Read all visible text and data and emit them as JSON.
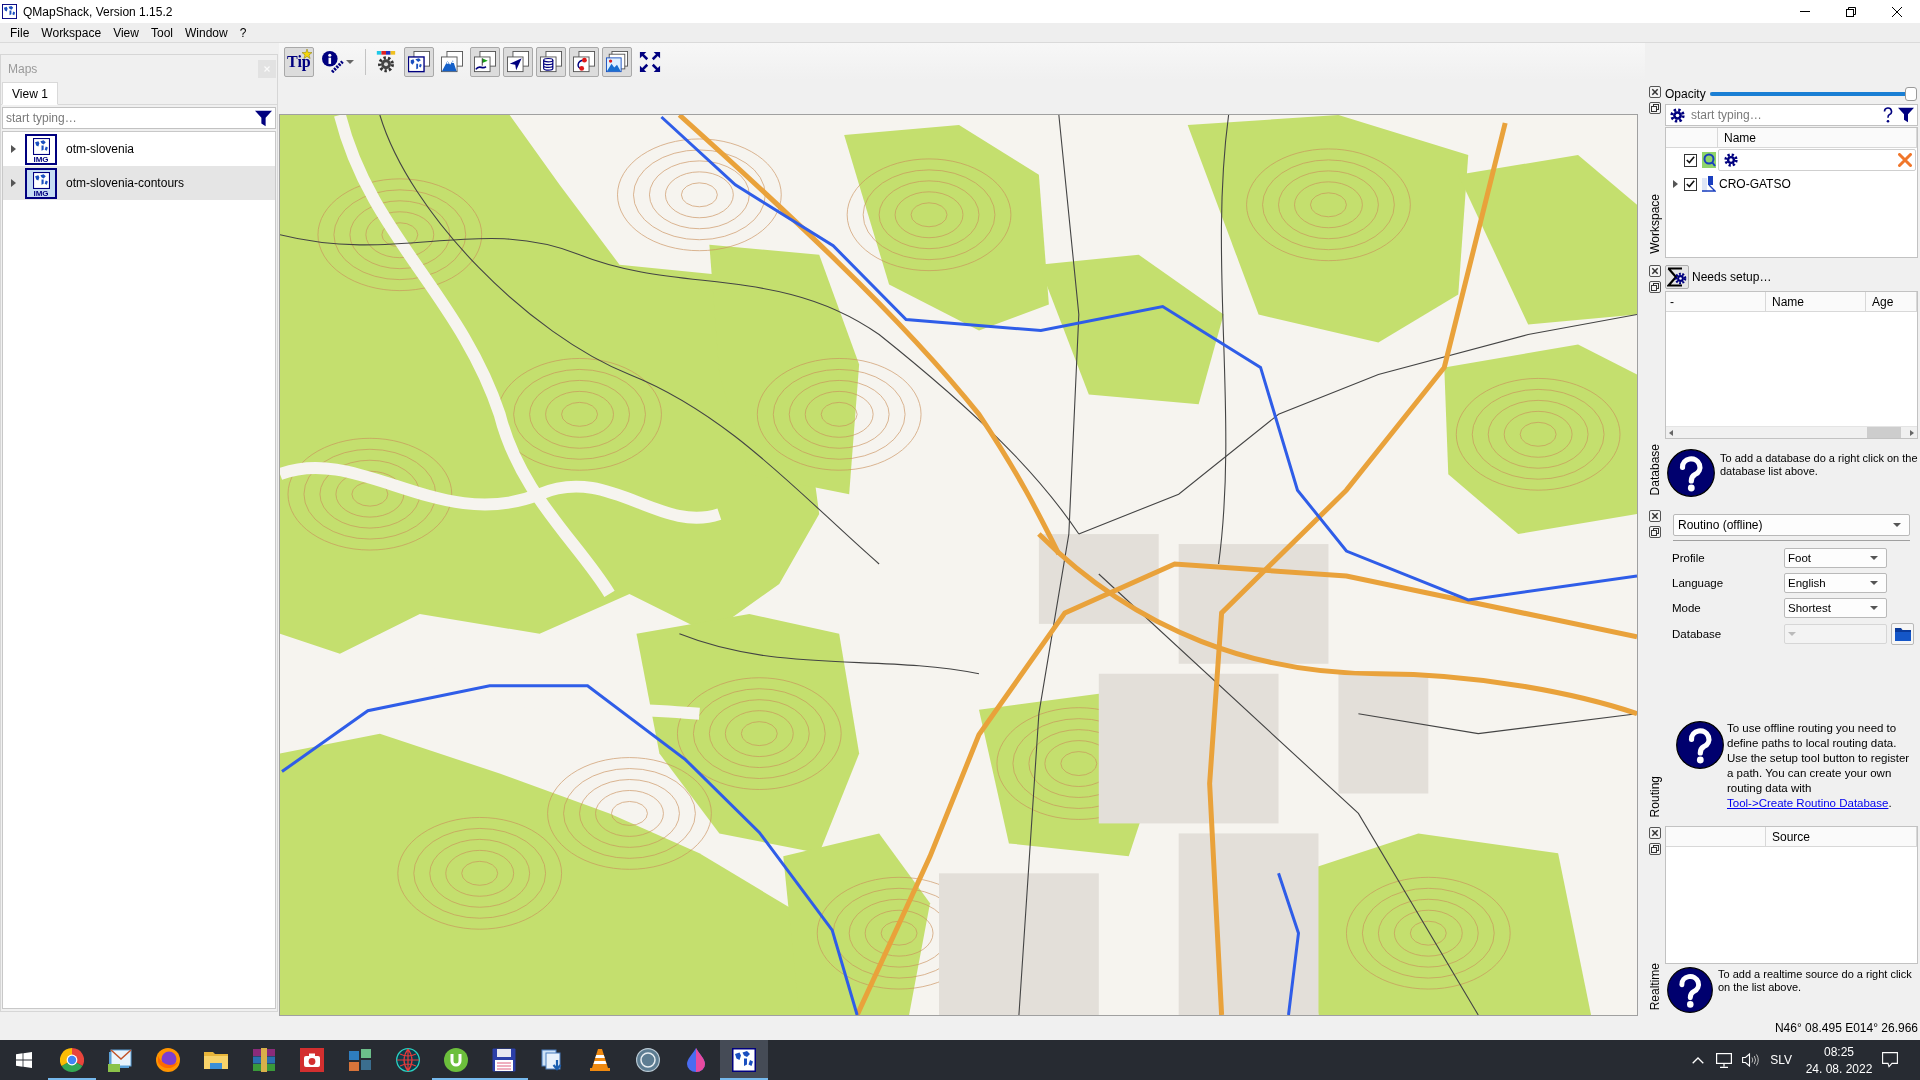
{
  "window": {
    "title": "QMapShack, Version 1.15.2"
  },
  "menu": [
    "File",
    "Workspace",
    "View",
    "Tool",
    "Window",
    "?"
  ],
  "toolbar": [
    {
      "kind": "tip",
      "label": "Tip",
      "pressed": true
    },
    {
      "kind": "info",
      "pressed": false
    },
    {
      "kind": "separator"
    },
    {
      "kind": "setup",
      "pressed": false
    },
    {
      "kind": "maps",
      "pressed": true
    },
    {
      "kind": "dem",
      "pressed": false
    },
    {
      "kind": "tracks",
      "pressed": true
    },
    {
      "kind": "routes",
      "pressed": true
    },
    {
      "kind": "database",
      "pressed": true
    },
    {
      "kind": "routing",
      "pressed": true
    },
    {
      "kind": "realtime",
      "pressed": true
    },
    {
      "kind": "fullscreen",
      "pressed": false
    }
  ],
  "maps_dock": {
    "title": "Maps",
    "tabs": [
      {
        "label": "View 1",
        "selected": true
      }
    ],
    "search": {
      "placeholder": "start typing…"
    },
    "items": [
      {
        "name": "otm-slovenia",
        "format": "IMG",
        "expanded": false,
        "selected": false
      },
      {
        "name": "otm-slovenia-contours",
        "format": "IMG",
        "expanded": false,
        "selected": true
      }
    ]
  },
  "workspace": {
    "title": "Workspace",
    "opacity": {
      "label": "Opacity",
      "level": 1
    },
    "search": {
      "placeholder": "start typing…"
    },
    "columns": [
      "Name"
    ],
    "items": [
      {
        "kind": "filter",
        "checked": true
      },
      {
        "kind": "project",
        "name": "CRO-GATSO",
        "checked": true,
        "expanded": false
      }
    ]
  },
  "database": {
    "title": "Database",
    "setup_label": "Needs setup…",
    "columns": [
      "-",
      "Name",
      "Age"
    ],
    "help": "To add a database do a right click on the database list above."
  },
  "routing": {
    "title": "Routing",
    "router": "Routino (offline)",
    "fields": [
      {
        "label": "Profile",
        "value": "Foot",
        "disabled": false
      },
      {
        "label": "Language",
        "value": "English",
        "disabled": false
      },
      {
        "label": "Mode",
        "value": "Shortest",
        "disabled": false
      },
      {
        "label": "Database",
        "disabled": true
      }
    ],
    "help": {
      "text": "To use offline routing you need to define paths to local routing data. Use the setup tool button to register a path. You can create your own routing data with",
      "link": "Tool->Create Routino Database",
      "text_after": "."
    }
  },
  "realtime": {
    "title": "Realtime",
    "columns": [
      "Source"
    ],
    "help": "To add a realtime source do a right click on the list above."
  },
  "status_bar": {
    "position": "N46° 08.495 E014° 26.966"
  },
  "taskbar": {
    "apps": [
      {
        "kind": "ball",
        "running": true,
        "selected": false
      },
      {
        "kind": "mail",
        "running": false,
        "selected": false
      },
      {
        "kind": "foxball",
        "running": false,
        "selected": false
      },
      {
        "kind": "folder",
        "running": false,
        "selected": false
      },
      {
        "kind": "archive",
        "running": false,
        "selected": false
      },
      {
        "kind": "camera",
        "running": false,
        "selected": false
      },
      {
        "kind": "tiles",
        "running": false,
        "selected": false
      },
      {
        "kind": "globe",
        "running": false,
        "selected": false
      },
      {
        "kind": "torrent",
        "running": true,
        "selected": false
      },
      {
        "kind": "floppy",
        "running": true,
        "selected": false
      },
      {
        "kind": "download",
        "running": false,
        "selected": false
      },
      {
        "kind": "cone",
        "running": false,
        "selected": false
      },
      {
        "kind": "player",
        "running": false,
        "selected": false
      },
      {
        "kind": "drop",
        "running": false,
        "selected": false
      },
      {
        "kind": "mapapp",
        "running": true,
        "selected": true
      }
    ],
    "tray": {
      "language": "SLV",
      "time": "08:25",
      "date": "24. 08. 2022"
    }
  }
}
